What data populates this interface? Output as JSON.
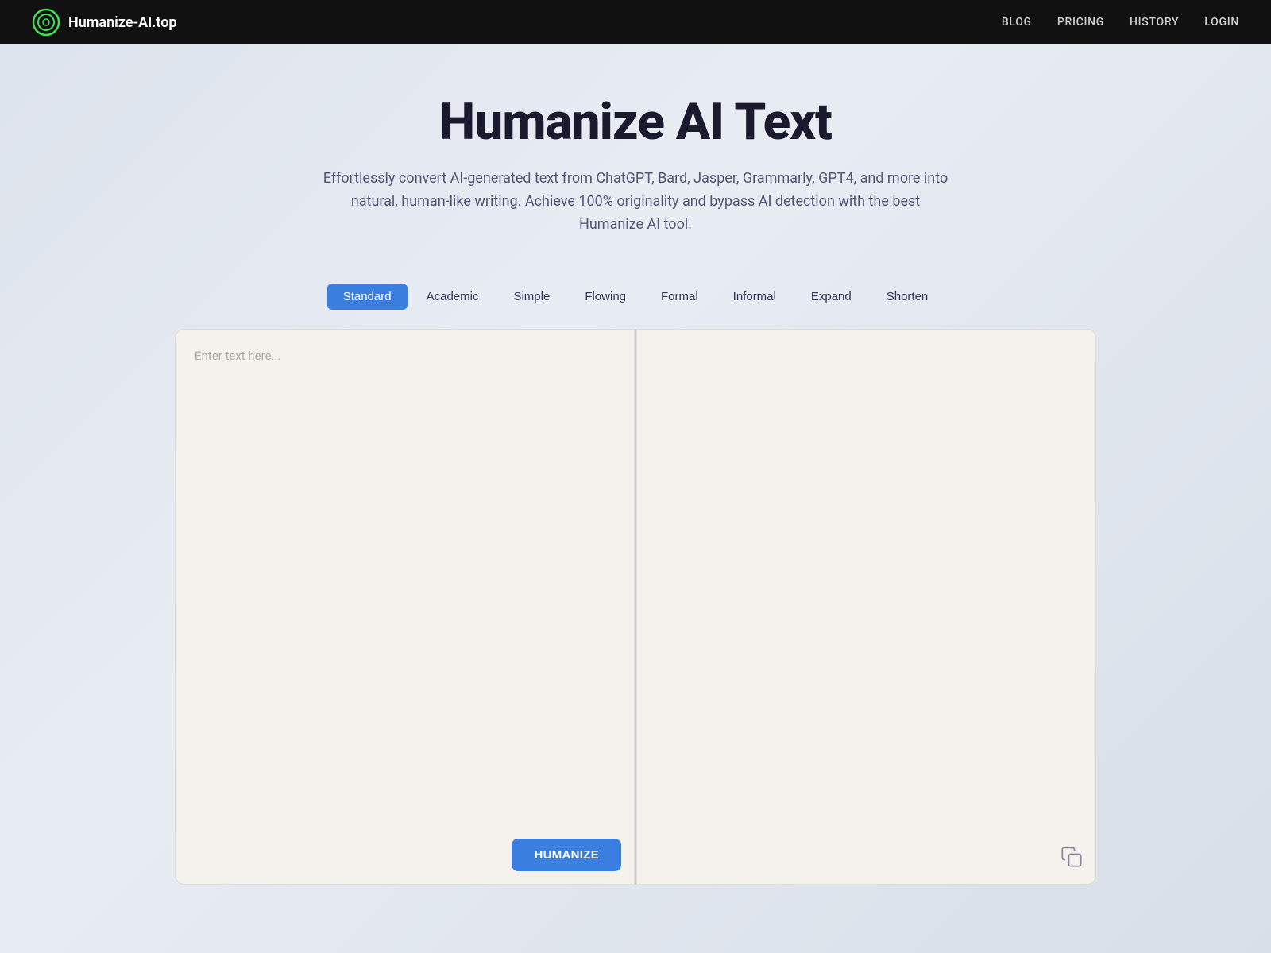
{
  "navbar": {
    "brand_name": "Humanize-AI.top",
    "links": [
      {
        "label": "BLOG",
        "id": "blog"
      },
      {
        "label": "PRICING",
        "id": "pricing"
      },
      {
        "label": "HISTORY",
        "id": "history"
      },
      {
        "label": "LOGIN",
        "id": "login"
      }
    ]
  },
  "hero": {
    "title": "Humanize AI Text",
    "subtitle": "Effortlessly convert AI-generated text from ChatGPT, Bard, Jasper, Grammarly, GPT4, and more into natural, human-like writing. Achieve 100% originality and bypass AI detection with the best Humanize AI tool."
  },
  "tabs": [
    {
      "label": "Standard",
      "id": "standard",
      "active": true
    },
    {
      "label": "Academic",
      "id": "academic",
      "active": false
    },
    {
      "label": "Simple",
      "id": "simple",
      "active": false
    },
    {
      "label": "Flowing",
      "id": "flowing",
      "active": false
    },
    {
      "label": "Formal",
      "id": "formal",
      "active": false
    },
    {
      "label": "Informal",
      "id": "informal",
      "active": false
    },
    {
      "label": "Expand",
      "id": "expand",
      "active": false
    },
    {
      "label": "Shorten",
      "id": "shorten",
      "active": false
    }
  ],
  "editor": {
    "input_placeholder": "Enter text here...",
    "humanize_button_label": "HUMANIZE"
  }
}
